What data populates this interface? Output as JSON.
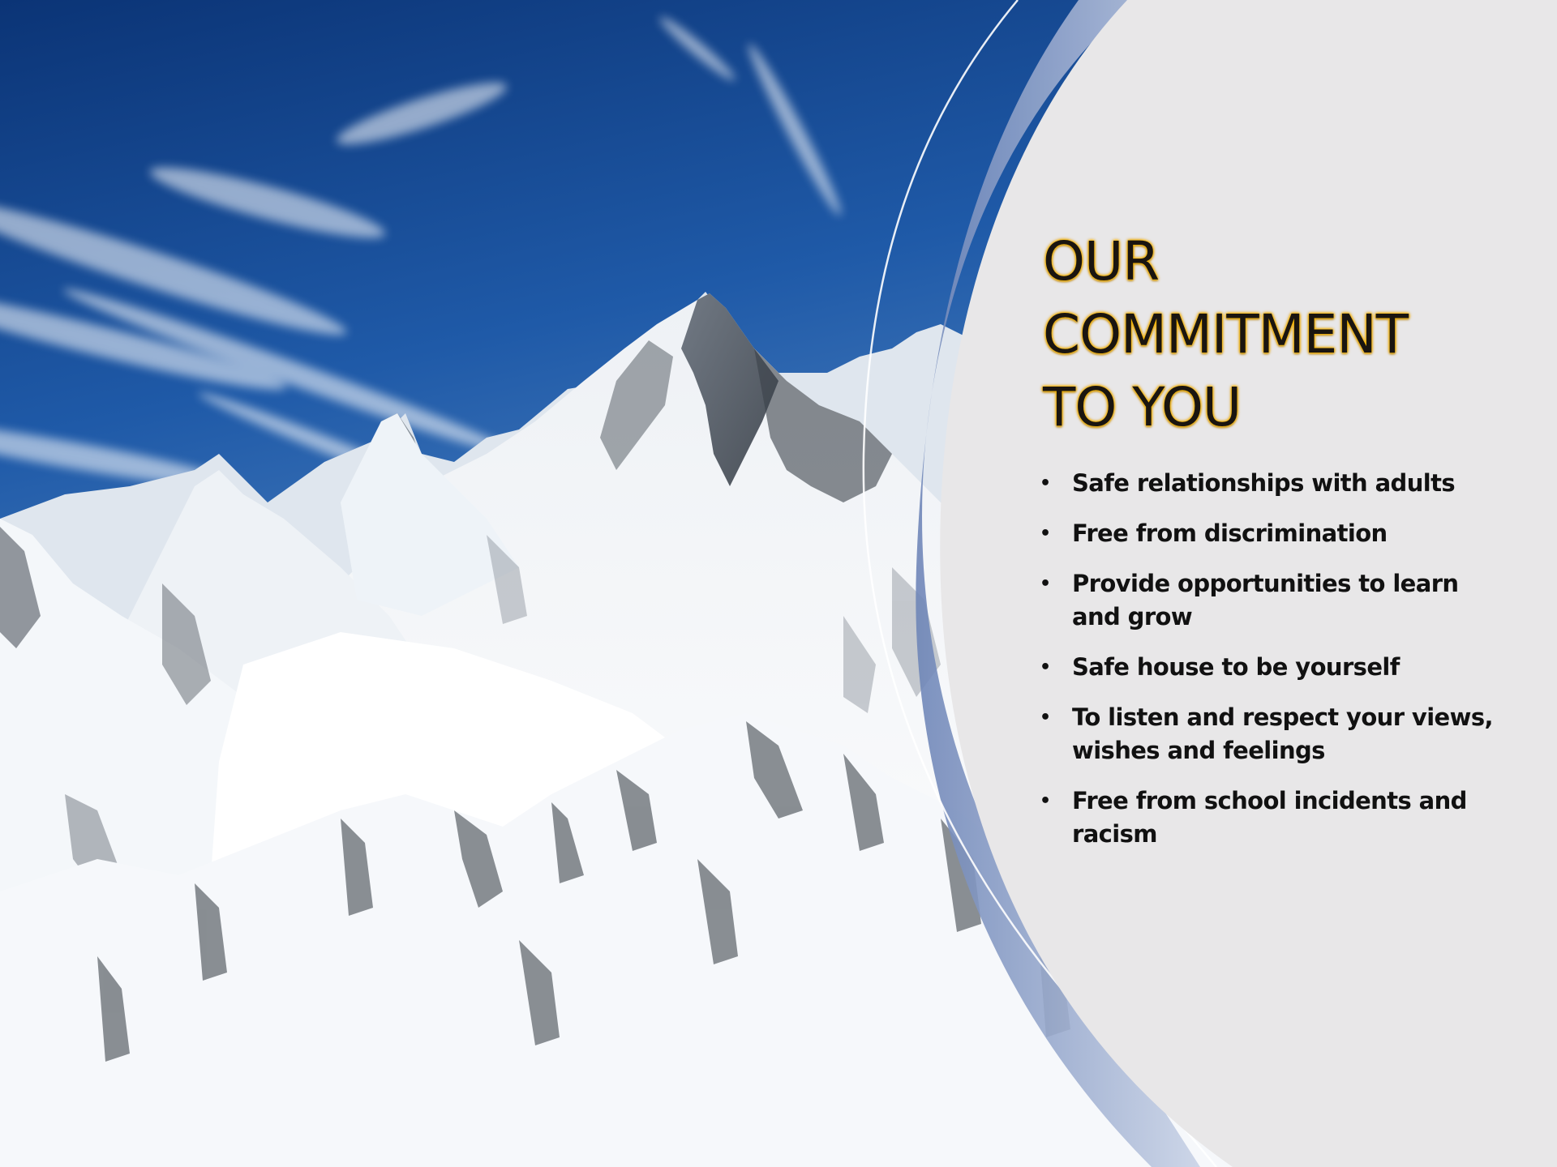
{
  "slide": {
    "title_lines": [
      "OUR",
      "COMMITMENT",
      "TO YOU"
    ],
    "bullet_glyph": "•",
    "bullets": [
      "Safe relationships with adults",
      "Free from discrimination",
      "Provide opportunities to learn and grow",
      "Safe house to be yourself",
      "To listen and respect your views, wishes and feelings",
      "Free from school incidents and racism"
    ]
  },
  "colors": {
    "panel": "#e8e7e8",
    "sky_top": "#0e3a7e",
    "sky_bottom": "#6f9fd2",
    "title_glow": "#ffbf00",
    "text": "#111111"
  },
  "background_photo": "snow-covered mountain peaks under blue sky"
}
